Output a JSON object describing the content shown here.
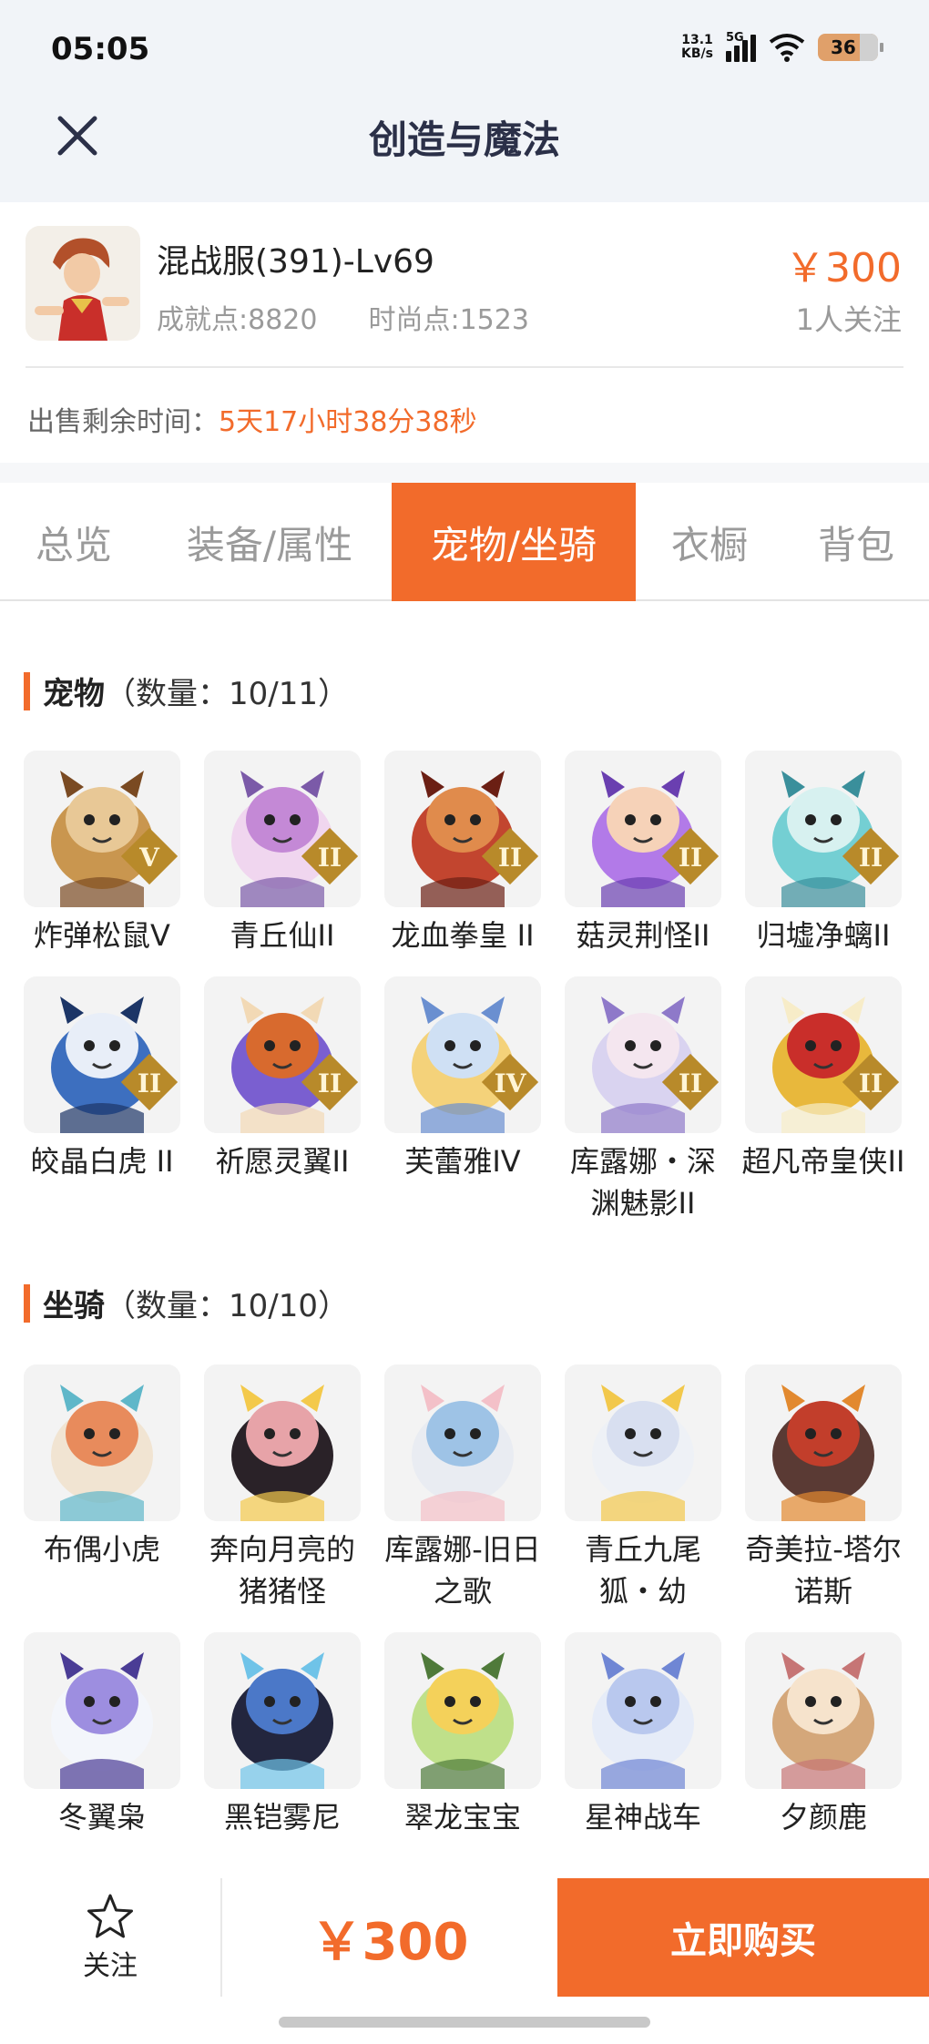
{
  "status_bar": {
    "time": "05:05",
    "net_speed_value": "13.1",
    "net_speed_unit": "KB/s",
    "network": "5G",
    "battery": "36"
  },
  "nav": {
    "title": "创造与魔法",
    "close_icon": "close-icon"
  },
  "listing": {
    "server": "混战服(391)-Lv69",
    "achievement": "成就点:8820",
    "fashion": "时尚点:1523",
    "price": "￥300",
    "followers": "1人关注",
    "remain_label": "出售剩余时间：",
    "remain_value": "5天17小时38分38秒"
  },
  "tabs": [
    "总览",
    "装备/属性",
    "宠物/坐骑",
    "衣橱",
    "背包"
  ],
  "active_tab": 2,
  "pets": {
    "title": "宠物",
    "count": "（数量：10/11）",
    "items": [
      {
        "name": "炸弹松鼠Ⅴ",
        "rank": "Ⅴ"
      },
      {
        "name": "青丘仙II",
        "rank": "II"
      },
      {
        "name": "龙血拳皇 II",
        "rank": "II"
      },
      {
        "name": "菇灵荆怪II",
        "rank": "II"
      },
      {
        "name": "归墟净螭II",
        "rank": "II"
      },
      {
        "name": "皎晶白虎 II",
        "rank": "II"
      },
      {
        "name": "祈愿灵翼II",
        "rank": "II"
      },
      {
        "name": "芙蕾雅IV",
        "rank": "IV"
      },
      {
        "name": "库露娜・深渊魅影II",
        "rank": "II"
      },
      {
        "name": "超凡帝皇侠II",
        "rank": "II"
      }
    ]
  },
  "mounts": {
    "title": "坐骑",
    "count": "（数量：10/10）",
    "items": [
      {
        "name": "布偶小虎"
      },
      {
        "name": "奔向月亮的猪猪怪"
      },
      {
        "name": "库露娜-旧日之歌"
      },
      {
        "name": "青丘九尾狐・幼"
      },
      {
        "name": "奇美拉-塔尔诺斯"
      },
      {
        "name": "冬翼枭"
      },
      {
        "name": "黑铠雾尼"
      },
      {
        "name": "翠龙宝宝"
      },
      {
        "name": "星神战车"
      },
      {
        "name": "夕颜鹿"
      }
    ]
  },
  "footer": {
    "follow_label": "关注",
    "price": "￥300",
    "buy_label": "立即购买"
  },
  "colors": {
    "accent": "#f26b2b",
    "title": "#2b3048",
    "muted": "#9a9a9a"
  }
}
